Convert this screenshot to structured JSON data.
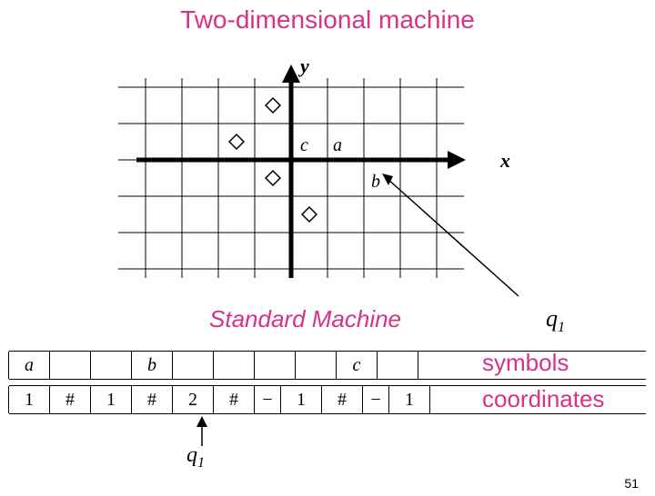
{
  "title": "Two-dimensional machine",
  "subtitle": "Standard Machine",
  "axes": {
    "x_label": "x",
    "y_label": "y"
  },
  "grid_labels": {
    "a": "a",
    "b": "b",
    "c": "c"
  },
  "head_symbol": "q",
  "head_subscript": "1",
  "tape": {
    "symbols_row": [
      "a",
      "",
      "",
      "b",
      "",
      "",
      "",
      "",
      "c",
      ""
    ],
    "coords_row": [
      "1",
      "#",
      "1",
      "#",
      "2",
      "#",
      "−",
      "1",
      "#",
      "−",
      "1"
    ]
  },
  "labels": {
    "symbols": "symbols",
    "coordinates": "coordinates"
  },
  "page_number": "51",
  "chart_data": {
    "type": "scatter",
    "title": "Two-dimensional machine",
    "xlabel": "x",
    "ylabel": "y",
    "xlim": [
      -4,
      5
    ],
    "ylim": [
      -3,
      3
    ],
    "series": [
      {
        "name": "head-positions",
        "marker": "diamond",
        "points": [
          {
            "x": -1,
            "y": 2
          },
          {
            "x": -2,
            "y": 1
          },
          {
            "x": -1,
            "y": 0
          },
          {
            "x": 0,
            "y": -1
          }
        ]
      }
    ],
    "annotations": [
      {
        "text": "a",
        "x": 1,
        "y": 1
      },
      {
        "text": "b",
        "x": 2,
        "y": 0
      },
      {
        "text": "c",
        "x": 0,
        "y": 1
      }
    ]
  }
}
